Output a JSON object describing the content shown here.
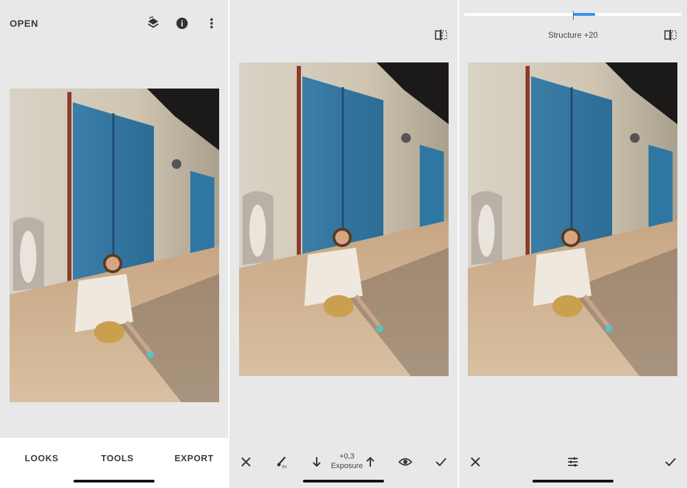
{
  "panel1": {
    "open_label": "OPEN",
    "icons": [
      "layers-icon",
      "info-icon",
      "more-vert-icon"
    ],
    "tabs": [
      {
        "label": "LOOKS"
      },
      {
        "label": "TOOLS"
      },
      {
        "label": "EXPORT"
      }
    ]
  },
  "panel2": {
    "exposure_value": "+0,3",
    "exposure_label": "Exposure",
    "icons": [
      "compare-icon",
      "close-icon",
      "brush-icon",
      "arrow-down-icon",
      "arrow-up-icon",
      "eye-icon",
      "check-icon"
    ]
  },
  "panel3": {
    "structure_label": "Structure +20",
    "slider": {
      "value": 20,
      "min": -100,
      "max": 100
    },
    "icons": [
      "compare-icon",
      "close-icon",
      "sliders-icon",
      "check-icon"
    ]
  },
  "colors": {
    "background": "#e8e8e8",
    "accent": "#3a8ee6",
    "bar_white": "#ffffff"
  }
}
